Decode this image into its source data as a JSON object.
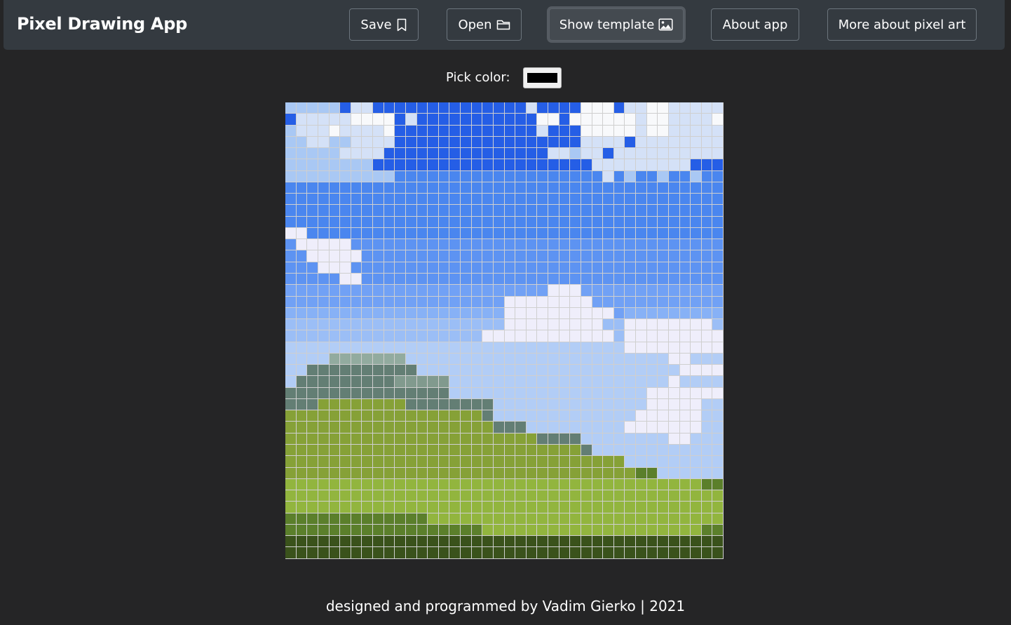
{
  "navbar": {
    "brand": "Pixel Drawing App",
    "buttons": [
      {
        "label": "Save",
        "icon": "bookmark-icon"
      },
      {
        "label": "Open",
        "icon": "folder-icon"
      },
      {
        "label": "Show template",
        "icon": "image-icon"
      },
      {
        "label": "About app"
      },
      {
        "label": "More about pixel art"
      }
    ]
  },
  "picker": {
    "label": "Pick color:",
    "value": "#000000"
  },
  "canvas": {
    "columns": 40,
    "rows": 40,
    "palette": {
      "a": "#a9c8f4",
      "b": "#255ee6",
      "c": "#d4e1f7",
      "d": "#cfe0fb",
      "w": "#f8f9fb",
      "L": "#4a86ef",
      "M": "#5d93f2",
      "N": "#71a1f5",
      "P": "#87b1f6",
      "Q": "#9bbef6",
      "R": "#b2cdf6",
      "V": "#efeefb",
      "s": "#92ab9f",
      "t": "#637e74",
      "u": "#819a8e",
      "g": "#86a137",
      "G": "#92b53e",
      "h": "#5b7f2b",
      "k": "#4a6a24",
      "K": "#3a521b"
    },
    "rows_data": [
      "aaaaabccbbbbbbbbbbbbbbcbbbbwwwbccwwccccc",
      "bcccccwwwwbcbbbbbbbbbbbwwbwwwwwwcwwccccw",
      "acccwccccwbbbbbbbbbbbbbcbbbwwwwwcwwccccc",
      "aaccaaccccbbbbbbbbbbbbbbbbbccccbcccccccc",
      "aaaaaccccbbbbbbbbbbbbbbbccaccbcccccccccc",
      "aaaaaaaabbbbbbbbbbbbbbbbbbbbcccccccccbbb",
      "aaaaaaaaaaLLLLLLLLLLLLLLLLLLLcLaLLaLLaLL",
      "LLLLLLLLLLLLLLLLLLLLLLLLLLLLLLLLLLLLLLLL",
      "LLLLLLLLLLLLLLLLLLLLLLLLLLLLLLLLLLLLLLLL",
      "LLLLLLLLLLLLLLLLLLLLLLLLLLLLLLLLLLLLLLLL",
      "LLLLLLLLLLLLLLLLLLLLLLLLLLLLLLLLLLLLLLLL",
      "VVLLLLLLLLLLLLLLLLLLLLLLLLLLLLLLLLLLLLLL",
      "MVVVVVMMMMMMMMMMMMMMMMMMMMMMMMMMMMMMMMMM",
      "MMVVVVVMMMMMMMMMMMMMMMMMMMMMMMMMMMMMMMMM",
      "MMMVVVMMMMMMMMMMMMMMMMMMMMMMMMMMMMMMMMMM",
      "MMMMMVVMMMMMMMMMMMMMMMMMMMMMMMMMMMMMMMMM",
      "NNNNNNNNNNNNNNNNNNNNNNNNVVVNNNNNNNNNNNNN",
      "NNNNNNNNNNNNNNNNNNNNVVVVVVVVNNNNNNNNNNNN",
      "PPPPPPPPPPPPPPPPPPPPVVVVVVVVVVNPPPPPPPPP",
      "QQQQQQQQQQQQQQQQQQQQVVVVVVVVVQQVVVVVVVVQ",
      "QQQQQQQQQQQQQQQQQQVVVVVVVVVVVVQVVVVVVVVV",
      "RRRRRRRRRRRRRRRRRRRRRRRRRRRRRRRVVVVVVVVV",
      "RRRRsssssssRRRRRRRRRRRRRRRRRRRRRRRRVVRRR",
      "RRttttttttttRRRRRRRRRRRRRRRRRRRRRRRRVVVV",
      "RtttttttttuuuuuRRRRRRRRRRRRRRRRRRRRVRRRR",
      "tttttttttttttttRRRRRRRRRRRRRRRRRRVVVVVVV",
      "tttggggggggttttttttRRRRRRRRRRRRRRVVVVVRR",
      "ggggggggggggggggggtRRRRRRRRRRRRRVVVVVVRR",
      "gggggggggggggggggggtttRRRRRRRRRVVVVVVVRR",
      "gggggggggggggggggggggggttttRRRRRRRRVVRRR",
      "gggggggggggggggggggggggggggtRRRRRRRRRRRR",
      "gggggggggggggggggggggggggggggggRRRRRRRRR",
      "gggggggggggggggggggggggggggggggghhRRRRRR",
      "GGGGGGGGGGGGGGGGGGGGGGGGGGGGGGGGGGGGGGhh",
      "GGGGGGGGGGGGGGGGGGGGGGGGGGGGGGGGGGGGGGGG",
      "GGGGGGGGGGGGGGGGGGGGGGGGGGGGGGGGGGGGGGGG",
      "hhhhhhhhhhhhhGGGGGGGGGGGGGGGGGGGGGGGGGGG",
      "hhhhhhhhhhhhhhhhhhGGGGGGGGGGGGGGGGGGGGhh",
      "KKKKKKKKKKKKKKKKKKKhhhhhhhhhhhhhhhhhhhhh",
      "KKKKKKKKKKKKKKKKKKKKKKKKKKKKKKKKKKKKKKKK"
    ],
    "extra_rows": [
      "KKKKKKKKKKKKKKKKKKKKKKKKKKKKKKKKKKKKKKKK",
      "KKKKKKKKKKKKKKKKKKKKKKKKKKKKKKKKKKKKKKKK"
    ]
  },
  "footer": {
    "text": "designed and programmed by Vadim Gierko | 2021"
  }
}
